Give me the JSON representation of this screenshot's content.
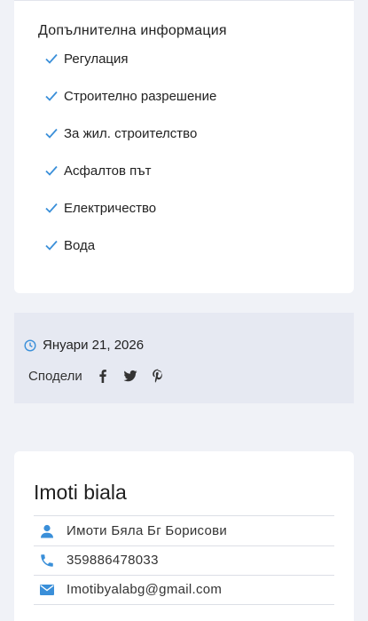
{
  "info": {
    "title": "Допълнителна информация",
    "features": [
      "Регулация",
      "Строително разрешение",
      "За жил. строителство",
      "Асфалтов път",
      "Електричество",
      "Вода"
    ],
    "check_icon": "check-icon",
    "accent_color": "#3a8fd9"
  },
  "meta": {
    "date": "Януари 21, 2026",
    "share_label": "Сподели",
    "share_icons": [
      "facebook-icon",
      "twitter-icon",
      "pinterest-icon"
    ]
  },
  "agent": {
    "name": "Imoti biala",
    "contacts": [
      {
        "icon": "person-icon",
        "text": "Имоти Бяла Бг Борисови"
      },
      {
        "icon": "phone-icon",
        "text": "359886478033"
      },
      {
        "icon": "email-icon",
        "text": "Imotibyalabg@gmail.com"
      }
    ]
  }
}
